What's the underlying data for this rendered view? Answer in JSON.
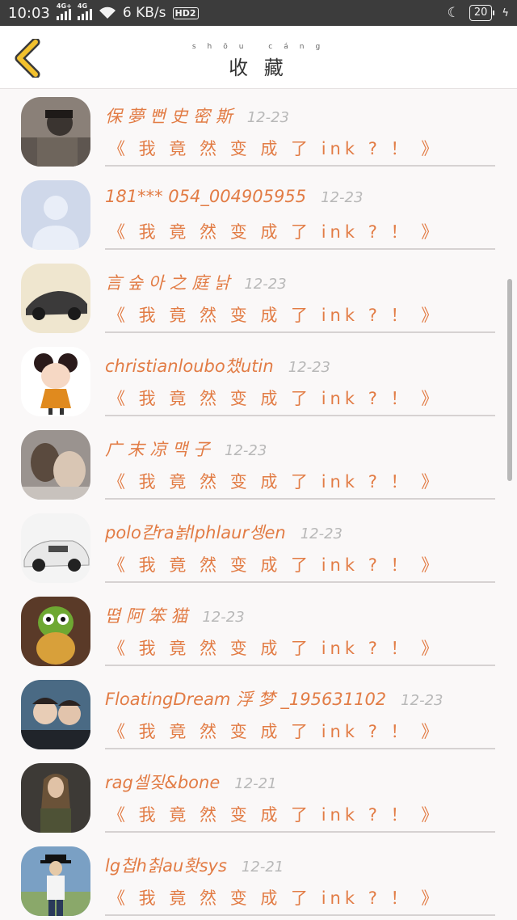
{
  "status": {
    "time": "10:03",
    "net1": "4G+",
    "net2": "4G",
    "speed": "6 KB/s",
    "hd": "HD2",
    "battery": "20"
  },
  "header": {
    "title": "收 藏",
    "title_pinyin": "shōu cáng"
  },
  "items": [
    {
      "name": "保 夢 뻔 史 密 斯",
      "date": "12-23",
      "message": "《 我 竟 然 变 成 了 ink ? ！ 》",
      "avatar": "man-with-cap-photo"
    },
    {
      "name": "181*** 054_004905955",
      "date": "12-23",
      "message": "《 我 竟 然 变 成 了 ink ? ！ 》",
      "avatar": "default-user-silhouette"
    },
    {
      "name": "言 숲 아 之 庭 낡",
      "date": "12-23",
      "message": "《 我 竟 然 变 成 了 ink ? ！ 》",
      "avatar": "car-photo"
    },
    {
      "name": "christianloubo챘utin",
      "date": "12-23",
      "message": "《 我 竟 然 变 成 了 ink ? ！ 》",
      "avatar": "cartoon-girl"
    },
    {
      "name": "广 末 凉 맥 子",
      "date": "12-23",
      "message": "《 我 竟 然 变 成 了 ink ? ！ 》",
      "avatar": "people-with-cat-photo"
    },
    {
      "name": "polo캳ra놝lphlaur셍en",
      "date": "12-23",
      "message": "《 我 竟 然 变 成 了 ink ? ！ 》",
      "avatar": "white-car-photo"
    },
    {
      "name": "뗩 阿 笨 猫",
      "date": "12-23",
      "message": "《 我 竟 然 变 成 了 ink ? ！ 》",
      "avatar": "pineapple-owl-photo"
    },
    {
      "name": "FloatingDream 浮 梦 _195631102",
      "date": "12-23",
      "message": "《 我 竟 然 变 成 了 ink ? ！ 》",
      "avatar": "two-people-photo"
    },
    {
      "name": "rag셀짖&bone",
      "date": "12-21",
      "message": "《 我 竟 然 变 成 了 ink ? ！ 》",
      "avatar": "long-hair-person-photo"
    },
    {
      "name": "lg첩h칡au홧sys",
      "date": "12-21",
      "message": "《 我 竟 然 变 成 了 ink ? ！ 》",
      "avatar": "person-in-hat-photo"
    }
  ],
  "colors": {
    "accent": "#e27c45",
    "back_icon": "#f2c12e",
    "date": "#b8b8b8"
  }
}
